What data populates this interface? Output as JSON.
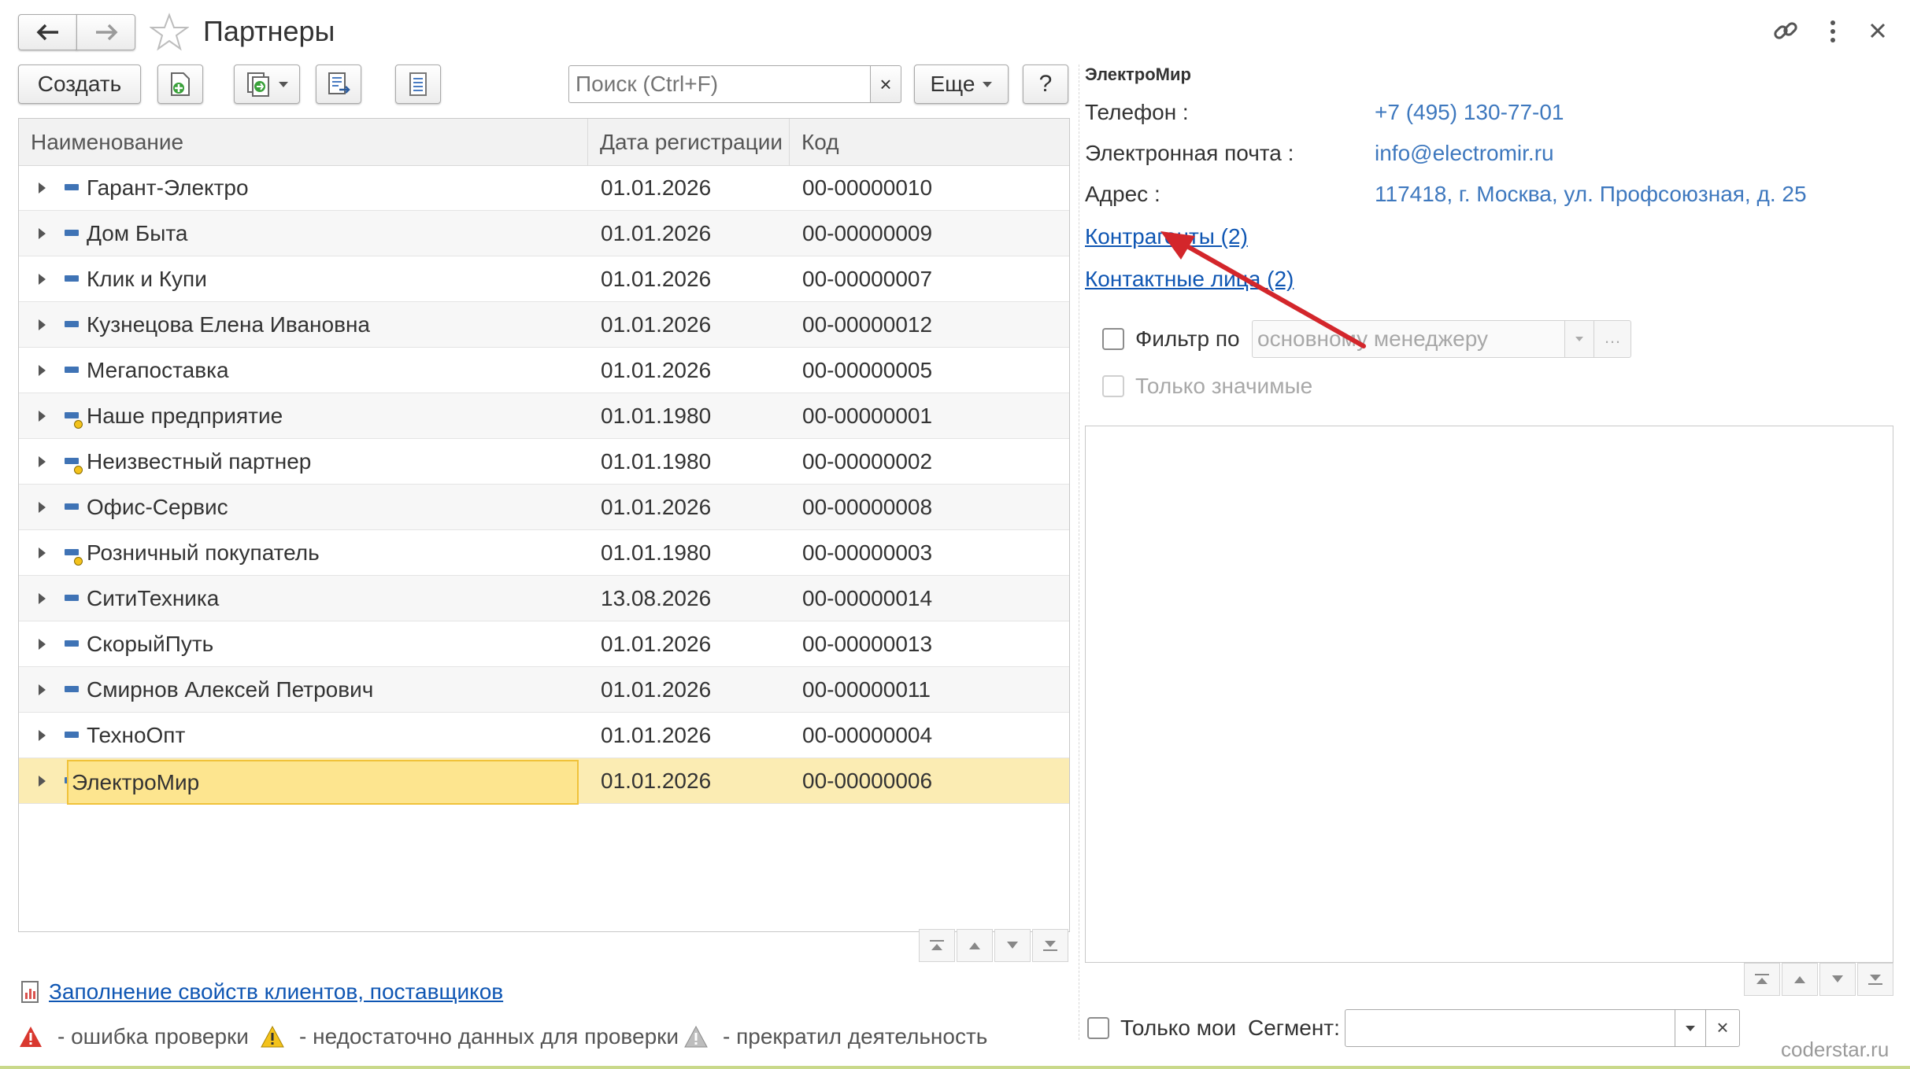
{
  "window": {
    "title": "Партнеры"
  },
  "toolbar": {
    "create_label": "Создать",
    "search_placeholder": "Поиск (Ctrl+F)",
    "more_label": "Еще",
    "help_label": "?",
    "clear_label": "×"
  },
  "table": {
    "columns": [
      "Наименование",
      "Дата регистрации",
      "Код"
    ],
    "rows": [
      {
        "name": "Гарант-Электро",
        "date": "01.01.2026",
        "code": "00-00000010",
        "icon": "partner-icon"
      },
      {
        "name": "Дом Быта",
        "date": "01.01.2026",
        "code": "00-00000009",
        "icon": "partner-icon"
      },
      {
        "name": "Клик и Купи",
        "date": "01.01.2026",
        "code": "00-00000007",
        "icon": "partner-icon"
      },
      {
        "name": "Кузнецова Елена Ивановна",
        "date": "01.01.2026",
        "code": "00-00000012",
        "icon": "partner-icon"
      },
      {
        "name": "Мегапоставка",
        "date": "01.01.2026",
        "code": "00-00000005",
        "icon": "partner-icon"
      },
      {
        "name": "Наше предприятие",
        "date": "01.01.1980",
        "code": "00-00000001",
        "icon": "predefined-partner-icon"
      },
      {
        "name": "Неизвестный партнер",
        "date": "01.01.1980",
        "code": "00-00000002",
        "icon": "predefined-partner-icon"
      },
      {
        "name": "Офис-Сервис",
        "date": "01.01.2026",
        "code": "00-00000008",
        "icon": "partner-icon"
      },
      {
        "name": "Розничный покупатель",
        "date": "01.01.1980",
        "code": "00-00000003",
        "icon": "predefined-partner-icon"
      },
      {
        "name": "СитиТехника",
        "date": "13.08.2026",
        "code": "00-00000014",
        "icon": "partner-icon"
      },
      {
        "name": "СкорыйПуть",
        "date": "01.01.2026",
        "code": "00-00000013",
        "icon": "partner-icon"
      },
      {
        "name": "Смирнов Алексей Петрович",
        "date": "01.01.2026",
        "code": "00-00000011",
        "icon": "partner-icon"
      },
      {
        "name": "ТехноОпт",
        "date": "01.01.2026",
        "code": "00-00000004",
        "icon": "partner-icon"
      },
      {
        "name": "ЭлектроМир",
        "date": "01.01.2026",
        "code": "00-00000006",
        "icon": "partner-icon"
      }
    ],
    "selected_index": 13
  },
  "footer": {
    "report_link": "Заполнение свойств клиентов, поставщиков",
    "legend": [
      {
        "icon": "error-icon",
        "text": "- ошибка проверки"
      },
      {
        "icon": "warning-icon",
        "text": "- недостаточно данных для проверки"
      },
      {
        "icon": "inactive-icon",
        "text": "- прекратил деятельность"
      }
    ]
  },
  "details": {
    "title": "ЭлектроМир",
    "phone_label": "Телефон :",
    "phone_value": "+7 (495) 130-77-01",
    "email_label": "Электронная почта :",
    "email_value": "info@electromir.ru",
    "address_label": "Адрес :",
    "address_value": "117418, г. Москва, ул. Профсоюзная, д. 25",
    "counterparties_link": "Контрагенты (2)",
    "contacts_link": "Контактные лица (2)",
    "filter_label": "Фильтр по",
    "filter_value": "основному менеджеру",
    "only_significant_label": "Только значимые",
    "only_mine_label": "Только мои",
    "segment_label": "Сегмент:",
    "segment_value": ""
  },
  "watermark": "coderstar.ru",
  "colors": {
    "accent": "#0f56b3",
    "selection": "#fbecb3",
    "annotation_arrow": "#d3262b"
  }
}
